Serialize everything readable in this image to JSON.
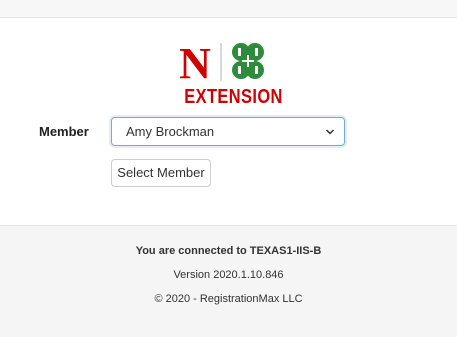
{
  "logo": {
    "letter": "N",
    "text": "EXTENSION",
    "colors": {
      "nebraska_red": "#d00000",
      "clover_green": "#2e8b3a"
    }
  },
  "member": {
    "label": "Member",
    "selected": "Amy Brockman"
  },
  "select_button_label": "Select Member",
  "footer": {
    "connected": "You are connected to TEXAS1-IIS-B",
    "version": "Version 2020.1.10.846",
    "copyright": "© 2020 - RegistrationMax LLC"
  },
  "icons": {
    "select_chevron": "chevron-down-icon",
    "clover": "four-h-clover-icon"
  }
}
